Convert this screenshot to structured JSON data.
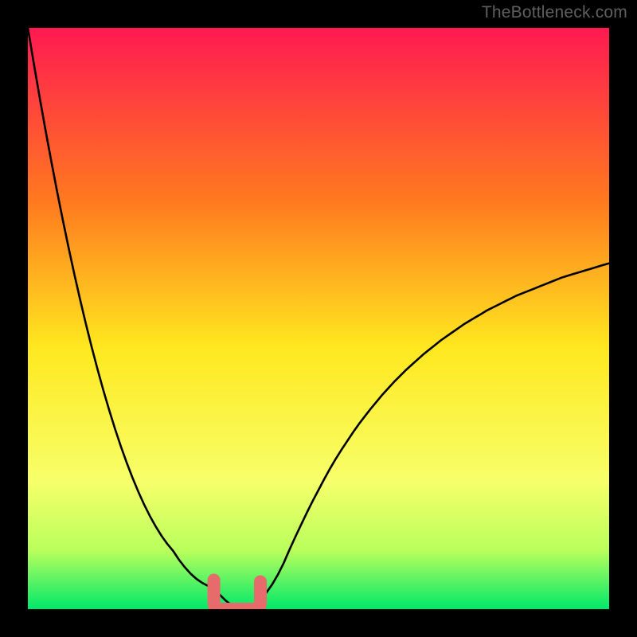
{
  "watermark": "TheBottleneck.com",
  "chart_data": {
    "type": "line",
    "title": "",
    "xlabel": "",
    "ylabel": "",
    "xlim": [
      0,
      100
    ],
    "ylim": [
      0,
      100
    ],
    "grid": false,
    "legend": false,
    "annotations": [],
    "curve_y_percent": [
      100,
      94,
      88.2,
      82.6,
      77.2,
      72,
      67,
      62.2,
      57.6,
      53.2,
      49,
      45,
      41.2,
      37.6,
      34.2,
      31,
      28,
      25.2,
      22.6,
      20.2,
      18,
      16,
      14.2,
      12.6,
      11.2,
      10,
      8.5,
      7.2,
      6.1,
      5.2,
      4.5,
      4,
      3.5,
      2.5,
      1.5,
      0.7,
      0.3,
      0.2,
      0.4,
      0.9,
      1.7,
      2.8,
      4.2,
      5.9,
      7.9,
      10.2,
      12.4,
      14.5,
      16.6,
      18.6,
      20.5,
      22.4,
      24.2,
      25.9,
      27.5,
      29,
      30.5,
      31.9,
      33.2,
      34.5,
      35.7,
      36.9,
      38,
      39.1,
      40.1,
      41.1,
      42,
      42.9,
      43.8,
      44.6,
      45.4,
      46.2,
      46.9,
      47.6,
      48.3,
      49,
      49.6,
      50.2,
      50.8,
      51.4,
      51.9,
      52.4,
      52.9,
      53.4,
      53.9,
      54.3,
      54.7,
      55.1,
      55.5,
      55.9,
      56.3,
      56.7,
      57.1,
      57.4,
      57.7,
      58,
      58.3,
      58.6,
      58.9,
      59.2,
      59.5
    ],
    "optimal_zone": {
      "x_start_pct": 32,
      "x_end_pct": 40,
      "floor_pct": 0,
      "height_pct": 5
    }
  },
  "colors": {
    "gradient_top": "#ff1a51",
    "gradient_mid1": "#ff7a1f",
    "gradient_mid2": "#ffe81f",
    "gradient_mid3": "#f7ff6a",
    "gradient_mid4": "#b8ff5c",
    "gradient_bottom": "#00e86a",
    "curve": "#000000",
    "marker_fill": "#e86b6b",
    "marker_stroke": "#a34040",
    "watermark": "#5f5f5f",
    "page_bg": "#000000"
  }
}
